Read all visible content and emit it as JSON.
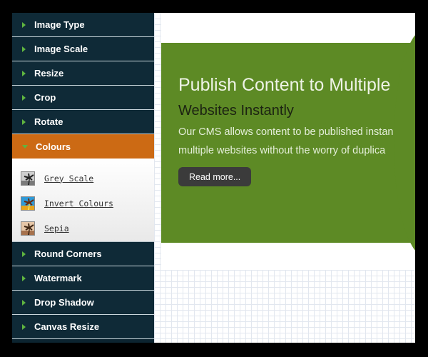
{
  "sidebar": {
    "items_top": [
      {
        "label": "Image Type"
      },
      {
        "label": "Image Scale"
      },
      {
        "label": "Resize"
      },
      {
        "label": "Crop"
      },
      {
        "label": "Rotate"
      }
    ],
    "active_item": {
      "label": "Colours"
    },
    "submenu": [
      {
        "label": "Grey Scale",
        "icon": "palm-tree-greyscale-icon"
      },
      {
        "label": "Invert Colours",
        "icon": "palm-tree-inverted-icon"
      },
      {
        "label": "Sepia",
        "icon": "palm-tree-sepia-icon"
      }
    ],
    "items_bottom": [
      {
        "label": "Round Corners"
      },
      {
        "label": "Watermark"
      },
      {
        "label": "Drop Shadow"
      },
      {
        "label": "Canvas Resize"
      }
    ],
    "colors": {
      "background": "#0f2a37",
      "active": "#cc6a14",
      "arrow": "#5fb540"
    }
  },
  "preview": {
    "title": "Publish Content to Multiple",
    "subtitle": "Websites Instantly",
    "text_line1": "Our CMS allows content to be published instan",
    "text_line2": "multiple websites without the worry of duplica",
    "button_label": "Read more...",
    "colors": {
      "banner": "#5d8a25",
      "button": "#3b3b3b"
    }
  }
}
